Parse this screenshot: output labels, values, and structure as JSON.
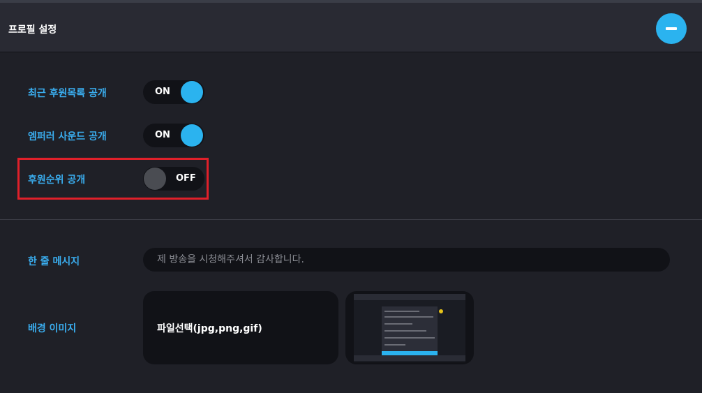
{
  "header": {
    "title": "프로필 설정"
  },
  "toggles": [
    {
      "label": "최근 후원목록 공개",
      "state": "ON"
    },
    {
      "label": "엠퍼러 사운드 공개",
      "state": "ON"
    },
    {
      "label": "후원순위 공개",
      "state": "OFF"
    }
  ],
  "message": {
    "label": "한 줄 메시지",
    "placeholder": "제 방송을 시청해주셔서 감사합니다."
  },
  "background": {
    "label": "배경 이미지",
    "button": "파일선택(jpg,png,gif)"
  },
  "colors": {
    "accent": "#2bb3ef",
    "highlight": "#e0202a"
  },
  "icons": {
    "collapse": "minus-icon"
  }
}
